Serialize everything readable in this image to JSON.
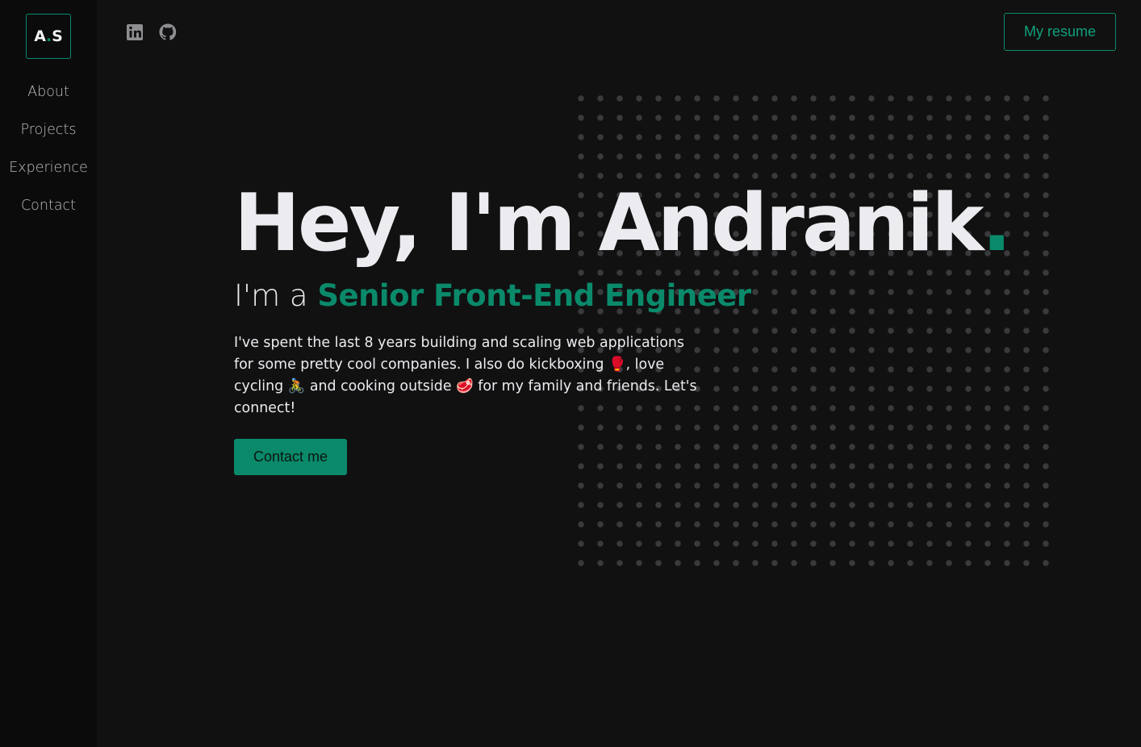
{
  "logo": {
    "left": "A",
    "dot": ".",
    "right": "S"
  },
  "nav": {
    "items": [
      {
        "label": "About"
      },
      {
        "label": "Projects"
      },
      {
        "label": "Experience"
      },
      {
        "label": "Contact"
      }
    ]
  },
  "social": {
    "icons": [
      "linkedin-icon",
      "github-icon"
    ]
  },
  "header": {
    "resume_label": "My resume"
  },
  "hero": {
    "heading": "Hey, I'm Andranik",
    "heading_period": ".",
    "subtitle_prefix": "I'm a",
    "subtitle_role": "Senior Front-End Engineer",
    "bio": "I've spent the last 8 years building and scaling web applications for some pretty cool companies. I also do kickboxing 🥊, love cycling 🚴 and cooking outside 🥩 for my family and friends. Let's connect!",
    "cta_label": "Contact me"
  },
  "colors": {
    "accent": "#0a8a6a",
    "background": "#111112",
    "sidebar": "#0b0b0c",
    "text": "#ececf0"
  }
}
